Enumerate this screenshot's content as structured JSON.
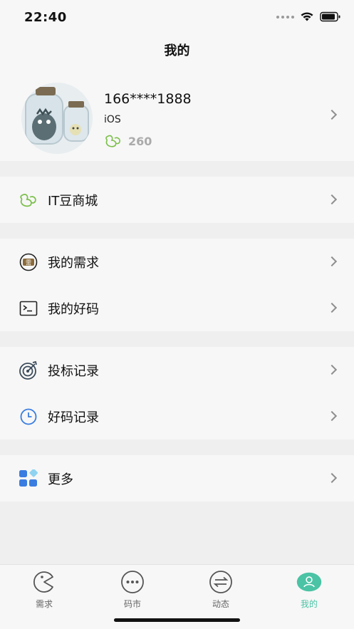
{
  "status_bar": {
    "time": "22:40"
  },
  "page_title": "我的",
  "profile": {
    "phone": "166****1888",
    "platform": "iOS",
    "beans": "260"
  },
  "menu": {
    "mall": "IT豆商城",
    "my_demands": "我的需求",
    "my_codes": "我的好码",
    "bid_records": "投标记录",
    "code_records": "好码记录",
    "more": "更多"
  },
  "tabs": [
    {
      "label": "需求",
      "icon": "pacman-icon"
    },
    {
      "label": "码市",
      "icon": "chat-dots-icon"
    },
    {
      "label": "动态",
      "icon": "swap-arrows-icon"
    },
    {
      "label": "我的",
      "icon": "user-icon"
    }
  ],
  "colors": {
    "accent": "#4bc3a5",
    "bean_green": "#7bbf4a",
    "blue": "#3a7de0"
  }
}
